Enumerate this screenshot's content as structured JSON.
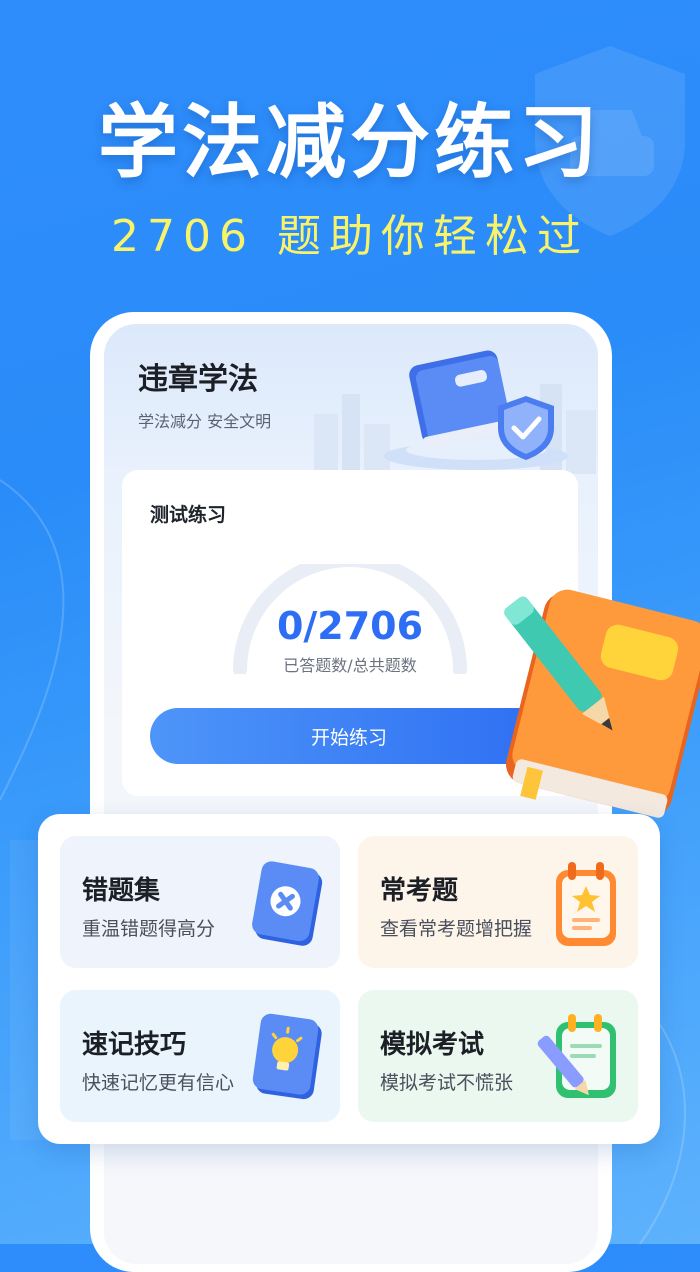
{
  "hero": {
    "title": "学法减分练习",
    "subtitle": "2706 题助你轻松过"
  },
  "app_card": {
    "title": "违章学法",
    "subtitle": "学法减分 安全文明"
  },
  "practice": {
    "title": "测试练习",
    "count": "0/2706",
    "count_label": "已答题数/总共题数",
    "answered": 0,
    "total": 2706,
    "start_button": "开始练习"
  },
  "features": [
    {
      "name": "错题集",
      "desc": "重温错题得高分",
      "icon": "wrong-answers-book-icon"
    },
    {
      "name": "常考题",
      "desc": "查看常考题增把握",
      "icon": "star-clipboard-icon"
    },
    {
      "name": "速记技巧",
      "desc": "快速记忆更有信心",
      "icon": "lightbulb-book-icon"
    },
    {
      "name": "模拟考试",
      "desc": "模拟考试不慌张",
      "icon": "exam-pencil-icon"
    }
  ],
  "colors": {
    "background": "#2f8dfb",
    "accent_yellow": "#f9f36a",
    "primary_blue": "#2d6ef5",
    "tile_blue": "#eef3fc",
    "tile_orange": "#fdf4ea",
    "tile_green": "#ebf8f0"
  }
}
